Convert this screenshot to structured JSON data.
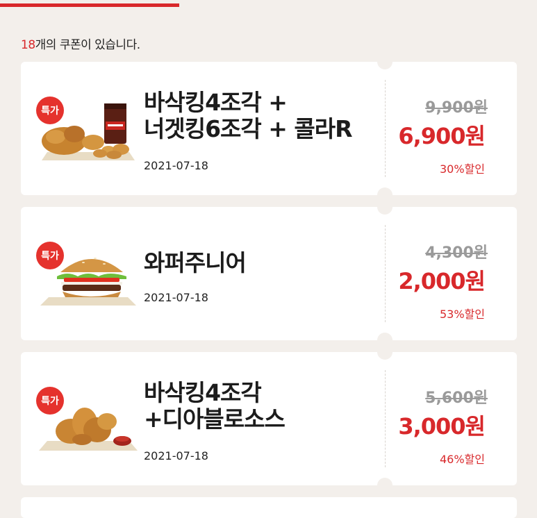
{
  "header": {
    "count": "18",
    "count_suffix": "개의 쿠폰이 있습니다."
  },
  "badge_label": "특가",
  "coupons": [
    {
      "title": "바삭킹4조각 +\n너겟킹6조각 + 콜라R",
      "date": "2021-07-18",
      "original_price": "9,900원",
      "sale_price": "6,900원",
      "discount": "30%할인",
      "image": "chicken-nuggets-cola"
    },
    {
      "title": "와퍼주니어",
      "date": "2021-07-18",
      "original_price": "4,300원",
      "sale_price": "2,000원",
      "discount": "53%할인",
      "image": "burger"
    },
    {
      "title": "바삭킹4조각\n+디아블로소스",
      "date": "2021-07-18",
      "original_price": "5,600원",
      "sale_price": "3,000원",
      "discount": "46%할인",
      "image": "fried-chicken-sauce"
    }
  ],
  "colors": {
    "accent": "#d8282b",
    "background": "#f3efeb",
    "card": "#ffffff"
  }
}
